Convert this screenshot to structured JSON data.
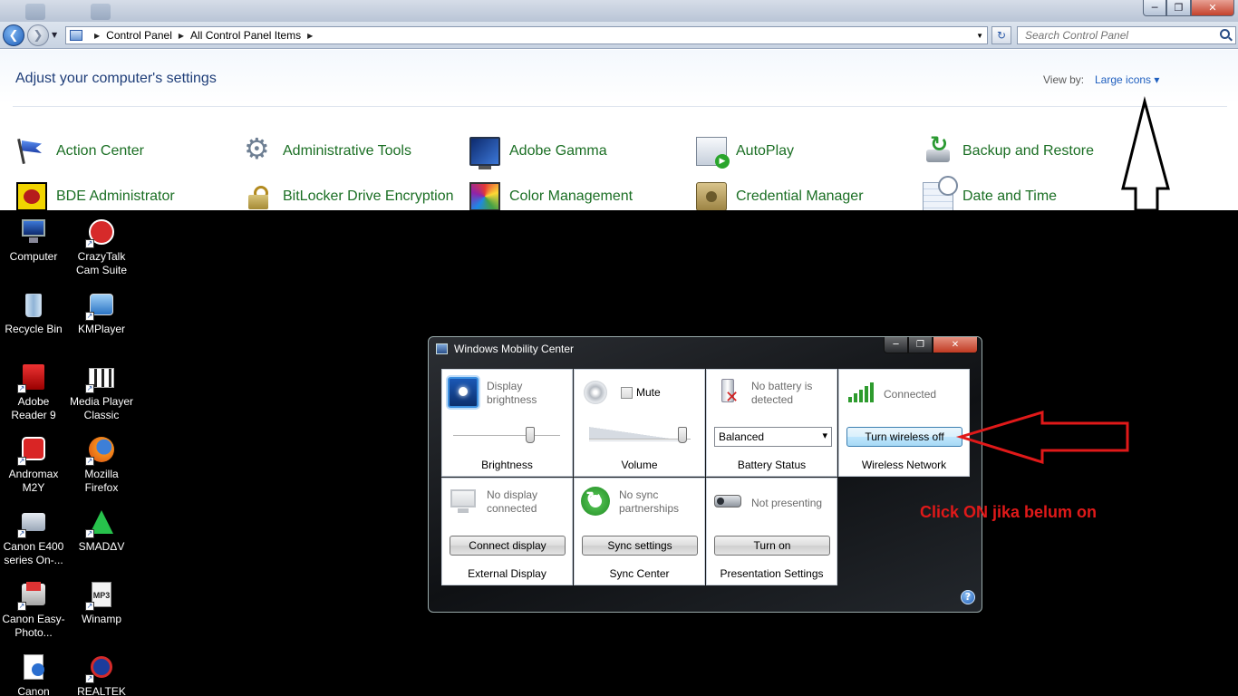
{
  "control_panel": {
    "breadcrumb": [
      "Control Panel",
      "All Control Panel Items"
    ],
    "search_placeholder": "Search Control Panel",
    "heading": "Adjust your computer's settings",
    "view_by_label": "View by:",
    "view_by_value": "Large icons",
    "items": [
      {
        "label": "Action Center",
        "icon": "flag-icon"
      },
      {
        "label": "Administrative Tools",
        "icon": "admin-tools-icon"
      },
      {
        "label": "Adobe Gamma",
        "icon": "monitor-icon"
      },
      {
        "label": "AutoPlay",
        "icon": "autoplay-icon"
      },
      {
        "label": "Backup and Restore",
        "icon": "backup-icon"
      },
      {
        "label": "BDE Administrator",
        "icon": "bde-icon"
      },
      {
        "label": "BitLocker Drive Encryption",
        "icon": "lock-icon"
      },
      {
        "label": "Color Management",
        "icon": "color-icon"
      },
      {
        "label": "Credential Manager",
        "icon": "vault-icon"
      },
      {
        "label": "Date and Time",
        "icon": "calendar-clock-icon"
      }
    ]
  },
  "desktop": {
    "icons": [
      {
        "label": "Computer"
      },
      {
        "label": "CrazyTalk Cam Suite"
      },
      {
        "label": "Recycle Bin"
      },
      {
        "label": "KMPlayer"
      },
      {
        "label": "Adobe Reader 9"
      },
      {
        "label": "Media Player Classic"
      },
      {
        "label": "Andromax M2Y"
      },
      {
        "label": "Mozilla Firefox"
      },
      {
        "label": "Canon E400 series On-..."
      },
      {
        "label": "SMADΔV"
      },
      {
        "label": "Canon Easy-Photo..."
      },
      {
        "label": "Winamp"
      },
      {
        "label": "Canon"
      },
      {
        "label": "REALTEK"
      }
    ]
  },
  "mobility_center": {
    "title": "Windows Mobility Center",
    "tiles": {
      "brightness": {
        "text": "Display brightness",
        "footer": "Brightness",
        "level": 0.72
      },
      "volume": {
        "mute_label": "Mute",
        "muted": false,
        "footer": "Volume",
        "level": 0.92
      },
      "battery": {
        "text": "No battery is detected",
        "plan": "Balanced",
        "footer": "Battery Status"
      },
      "wireless": {
        "text": "Connected",
        "button": "Turn wireless off",
        "footer": "Wireless Network"
      },
      "display": {
        "text": "No display connected",
        "button": "Connect display",
        "footer": "External Display"
      },
      "sync": {
        "text": "No sync partnerships",
        "button": "Sync settings",
        "footer": "Sync Center"
      },
      "presentation": {
        "text": "Not presenting",
        "button": "Turn on",
        "footer": "Presentation Settings"
      }
    }
  },
  "annotation": {
    "text": "Click ON jika belum on",
    "color": "#e01919"
  }
}
